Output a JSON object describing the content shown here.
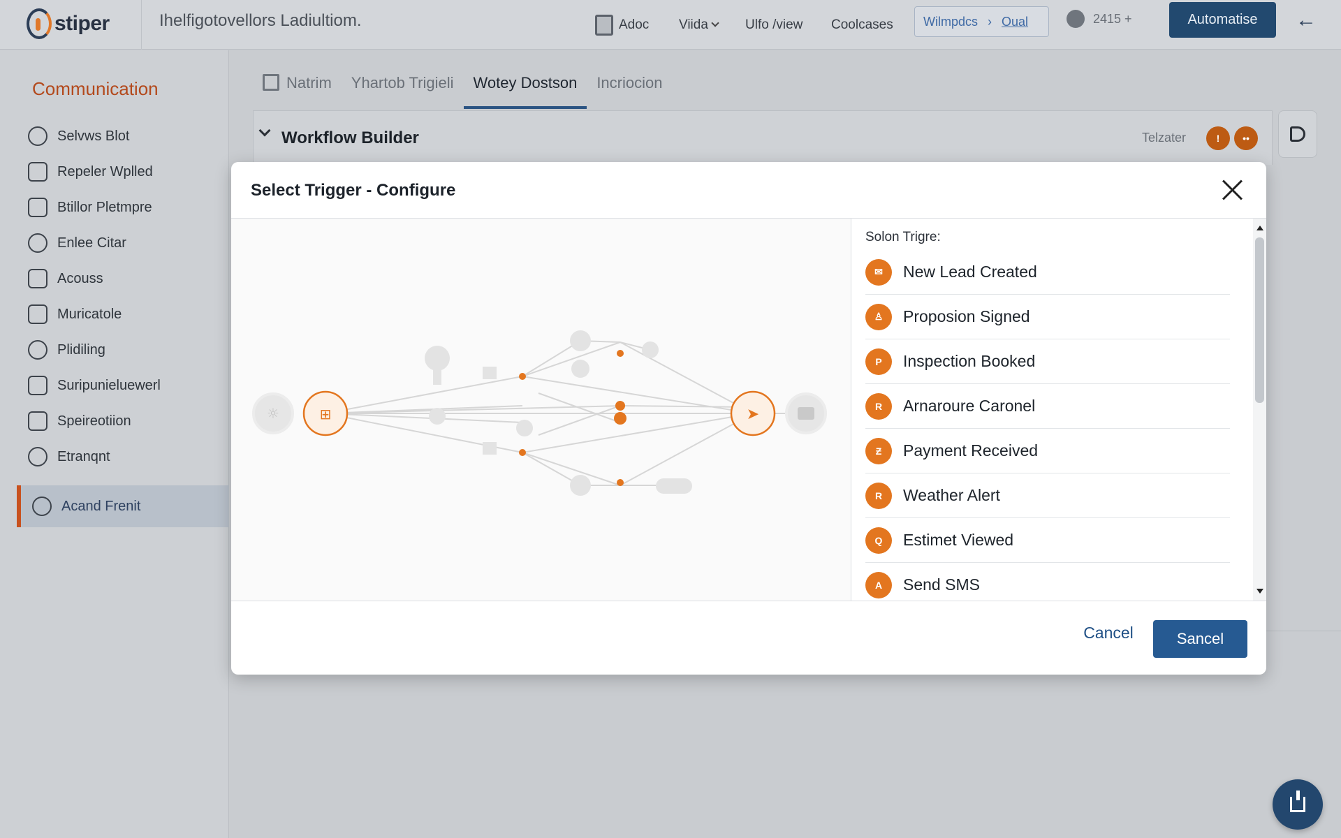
{
  "app": {
    "logo_text": "stiper",
    "title": "Ihelfigotovellors Ladiultiom."
  },
  "topnav": {
    "items": [
      "Adoc",
      "Viida",
      "Ulfo /view",
      "Coolcases"
    ],
    "breadcrumb": [
      "Wilmpdcs",
      "Oual"
    ],
    "counter": "2415 +",
    "primary_button": "Automatise"
  },
  "sidebar": {
    "title": "Communication",
    "items": [
      {
        "label": "Selvws Blot",
        "icon": "dollar-icon"
      },
      {
        "label": "Repeler Wplled",
        "icon": "shield-icon"
      },
      {
        "label": "Btillor Pletmpre",
        "icon": "monitor-icon"
      },
      {
        "label": "Enlee Citar",
        "icon": "coin-icon"
      },
      {
        "label": "Acouss",
        "icon": "mail-icon"
      },
      {
        "label": "Muricatole",
        "icon": "document-icon"
      },
      {
        "label": "Plidiling",
        "icon": "wifi-icon"
      },
      {
        "label": "Suripunieluewerl",
        "icon": "clipboard-icon"
      },
      {
        "label": "Speireotiion",
        "icon": "calendar-icon"
      },
      {
        "label": "Etranqnt",
        "icon": "location-icon"
      }
    ],
    "active_item": {
      "label": "Acand Frenit",
      "icon": "user-icon"
    }
  },
  "tabs": [
    "Natrim",
    "Yhartob Trigieli",
    "Wotey Dostson",
    "Incriocion"
  ],
  "workflow": {
    "title": "Workflow Builder",
    "status_label": "Telzater"
  },
  "modal": {
    "title": "Select Trigger - Configure",
    "list_heading": "Solon Trigre:",
    "triggers": [
      {
        "label": "New Lead Created",
        "icon": "inbox-icon",
        "glyph": "✉"
      },
      {
        "label": "Proposion Signed",
        "icon": "user-icon",
        "glyph": "♙"
      },
      {
        "label": "Inspection Booked",
        "icon": "pin-icon",
        "glyph": "P"
      },
      {
        "label": "Arnaroure Caronel",
        "icon": "flag-icon",
        "glyph": "R"
      },
      {
        "label": "Payment Received",
        "icon": "payment-icon",
        "glyph": "Ƶ"
      },
      {
        "label": "Weather Alert",
        "icon": "alert-icon",
        "glyph": "R"
      },
      {
        "label": "Estimet Viewed",
        "icon": "search-icon",
        "glyph": "Q"
      },
      {
        "label": "Send SMS",
        "icon": "sms-icon",
        "glyph": "A"
      }
    ],
    "cancel_label": "Cancel",
    "confirm_label": "Sancel"
  },
  "colors": {
    "accent_orange": "#e3761f",
    "primary_blue": "#265a92",
    "sidebar_title": "#b3491c"
  }
}
